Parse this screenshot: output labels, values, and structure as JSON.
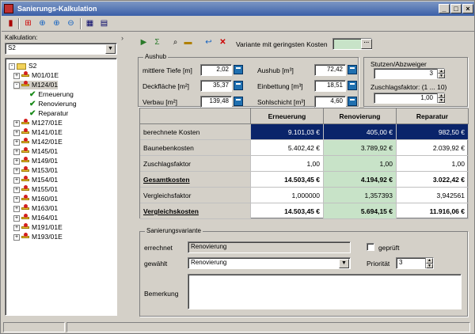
{
  "window": {
    "title": "Sanierungs-Kalkulation"
  },
  "left": {
    "kalk_label": "Kalkulation:",
    "kalk_value": "S2",
    "tree": [
      {
        "label": "S2",
        "level": 0,
        "expanded": true,
        "icon": "folder"
      },
      {
        "label": "M01/01E",
        "level": 1,
        "expander": "+",
        "icon": "manhole"
      },
      {
        "label": "M124/01",
        "level": 1,
        "expander": "-",
        "icon": "manhole",
        "highlight": true
      },
      {
        "label": "Erneuerung",
        "level": 2,
        "icon": "check"
      },
      {
        "label": "Renovierung",
        "level": 2,
        "icon": "check"
      },
      {
        "label": "Reparatur",
        "level": 2,
        "icon": "check"
      },
      {
        "label": "M127/01E",
        "level": 1,
        "expander": "+",
        "icon": "manhole"
      },
      {
        "label": "M141/01E",
        "level": 1,
        "expander": "+",
        "icon": "manhole"
      },
      {
        "label": "M142/01E",
        "level": 1,
        "expander": "+",
        "icon": "manhole"
      },
      {
        "label": "M145/01",
        "level": 1,
        "expander": "+",
        "icon": "manhole"
      },
      {
        "label": "M149/01",
        "level": 1,
        "expander": "+",
        "icon": "manhole"
      },
      {
        "label": "M153/01",
        "level": 1,
        "expander": "+",
        "icon": "manhole"
      },
      {
        "label": "M154/01",
        "level": 1,
        "expander": "+",
        "icon": "manhole"
      },
      {
        "label": "M155/01",
        "level": 1,
        "expander": "+",
        "icon": "manhole"
      },
      {
        "label": "M160/01",
        "level": 1,
        "expander": "+",
        "icon": "manhole"
      },
      {
        "label": "M163/01",
        "level": 1,
        "expander": "+",
        "icon": "manhole"
      },
      {
        "label": "M164/01",
        "level": 1,
        "expander": "+",
        "icon": "manhole"
      },
      {
        "label": "M191/01E",
        "level": 1,
        "expander": "+",
        "icon": "manhole"
      },
      {
        "label": "M193/01E",
        "level": 1,
        "expander": "+",
        "icon": "manhole"
      }
    ]
  },
  "right": {
    "variant_label": "Variante mit geringsten Kosten",
    "aushub": {
      "title": "Aushub",
      "mittlere_tiefe": {
        "label": "mittlere Tiefe [m]",
        "value": "2,02"
      },
      "deckflaeche": {
        "label": "Deckfläche [m²]",
        "value": "35,37"
      },
      "verbau": {
        "label": "Verbau [m²]",
        "value": "139,48"
      },
      "aushub_m3": {
        "label": "Aushub [m³]",
        "value": "72,42"
      },
      "einbettung": {
        "label": "Einbettung [m³]",
        "value": "18,51"
      },
      "sohlschicht": {
        "label": "Sohlschicht [m³]",
        "value": "4,60"
      }
    },
    "stutzen": {
      "title": "Stutzen/Abzweiger",
      "value": "3",
      "zuschlag_label": "Zuschlagsfaktor: (1 ... 10)",
      "zuschlag_value": "1,00"
    },
    "grid": {
      "columns": [
        "Erneuerung",
        "Renovierung",
        "Reparatur"
      ],
      "rows": [
        {
          "label": "berechnete Kosten",
          "values": [
            "9.101,03 €",
            "405,00 €",
            "982,50 €"
          ]
        },
        {
          "label": "Baunebenkosten",
          "values": [
            "5.402,42 €",
            "3.789,92 €",
            "2.039,92 €"
          ]
        },
        {
          "label": "Zuschlagsfaktor",
          "values": [
            "1,00",
            "1,00",
            "1,00"
          ]
        },
        {
          "label": "Gesamtkosten",
          "values": [
            "14.503,45 €",
            "4.194,92 €",
            "3.022,42 €"
          ]
        },
        {
          "label": "Vergleichsfaktor",
          "values": [
            "1,000000",
            "1,357393",
            "3,942561"
          ]
        },
        {
          "label": "Vergleichskosten",
          "values": [
            "14.503,45 €",
            "5.694,15 €",
            "11.916,06 €"
          ]
        }
      ]
    },
    "sanierung": {
      "title": "Sanierungsvariante",
      "errechnet_label": "errechnet",
      "errechnet_value": "Renovierung",
      "geprueft_label": "geprüft",
      "gewaehlt_label": "gewählt",
      "gewaehlt_value": "Renovierung",
      "prioritaet_label": "Priorität",
      "prioritaet_value": "3",
      "bemerkung_label": "Bemerkung"
    }
  }
}
